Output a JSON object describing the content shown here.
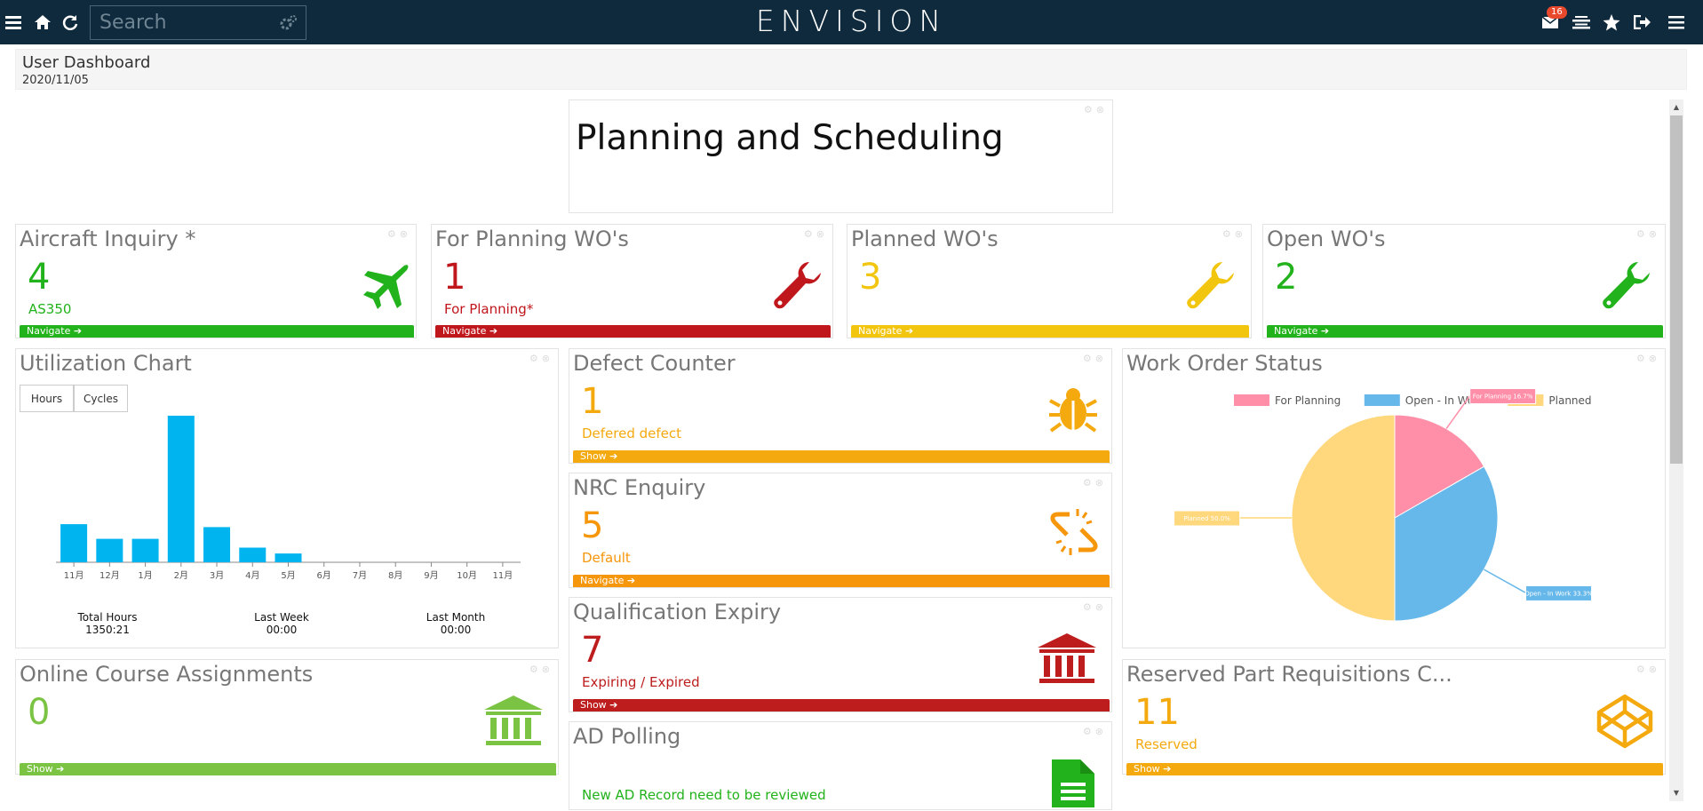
{
  "topbar": {
    "brand": "ENVISION",
    "search_placeholder": "Search",
    "mail_count": "16",
    "icons": [
      "menu-icon",
      "home-icon",
      "refresh-icon",
      "search-settings-icon",
      "mail-icon",
      "layers-icon",
      "star-icon",
      "logout-icon",
      "menu-right-icon"
    ]
  },
  "header": {
    "title": "User Dashboard",
    "date": "2020/11/05"
  },
  "main_title": "Planning and Scheduling",
  "cards": {
    "aircraft": {
      "title": "Aircraft Inquiry *",
      "count": "4",
      "sub": "AS350",
      "link": "Navigate",
      "color": "#22b21b",
      "icon": "airplane-icon"
    },
    "forplanning": {
      "title": "For Planning WO's",
      "count": "1",
      "sub": "For Planning*",
      "link": "Navigate",
      "color": "#c0171c",
      "icon": "wrench-icon"
    },
    "planned": {
      "title": "Planned WO's",
      "count": "3",
      "sub": "",
      "link": "Navigate",
      "color": "#f2c50f",
      "icon": "wrench-icon"
    },
    "open": {
      "title": "Open WO's",
      "count": "2",
      "sub": "",
      "link": "Navigate",
      "color": "#22b21b",
      "icon": "wrench-icon"
    },
    "defect": {
      "title": "Defect Counter",
      "count": "1",
      "sub": "Defered defect",
      "link": "Show",
      "color": "#f4a90f",
      "icon": "bug-icon"
    },
    "nrc": {
      "title": "NRC Enquiry",
      "count": "5",
      "sub": "Default",
      "link": "Navigate",
      "color": "#f6960b",
      "icon": "broken-link-icon"
    },
    "qualification": {
      "title": "Qualification Expiry",
      "count": "7",
      "sub": "Expiring / Expired",
      "link": "Show",
      "color": "#bd1d1d",
      "icon": "bank-icon"
    },
    "adpolling": {
      "title": "AD Polling",
      "count": "",
      "sub": "New AD Record need to be reviewed",
      "link": "",
      "color": "#22b21b",
      "icon": "document-icon"
    },
    "online": {
      "title": "Online Course Assignments",
      "count": "0",
      "sub": "",
      "link": "Show",
      "color": "#7bc342",
      "icon": "bank-icon"
    },
    "reserved": {
      "title": "Reserved Part Requisitions C...",
      "count": "11",
      "sub": "Reserved",
      "link": "Show",
      "color": "#f4a90f",
      "icon": "codepen-icon"
    }
  },
  "utilization": {
    "title": "Utilization Chart",
    "buttons": [
      "Hours",
      "Cycles"
    ],
    "stats": [
      {
        "label": "Total Hours",
        "value": "1350:21"
      },
      {
        "label": "Last Week",
        "value": "00:00"
      },
      {
        "label": "Last Month",
        "value": "00:00"
      }
    ]
  },
  "work_order_status": {
    "title": "Work Order Status",
    "legend": [
      "For Planning",
      "Open - In Work",
      "Planned"
    ],
    "labels": [
      "For Planning 16.7%",
      "Open - In Work 33.3%",
      "Planned 50.0%"
    ]
  },
  "chart_data": [
    {
      "type": "bar",
      "categories": [
        "11月",
        "12月",
        "1月",
        "2月",
        "3月",
        "4月",
        "5月",
        "6月",
        "7月",
        "8月",
        "9月",
        "10月",
        "11月"
      ],
      "values": [
        26,
        16,
        16,
        100,
        24,
        10,
        6,
        0,
        0,
        0,
        0,
        0,
        0
      ],
      "color": "#00b4f0",
      "grid": false
    },
    {
      "type": "pie",
      "categories": [
        "For Planning",
        "Open - In Work",
        "Planned"
      ],
      "values": [
        16.7,
        33.3,
        50.0
      ],
      "colors": [
        "#ff8fa8",
        "#66b8ea",
        "#ffd77c"
      ]
    }
  ]
}
